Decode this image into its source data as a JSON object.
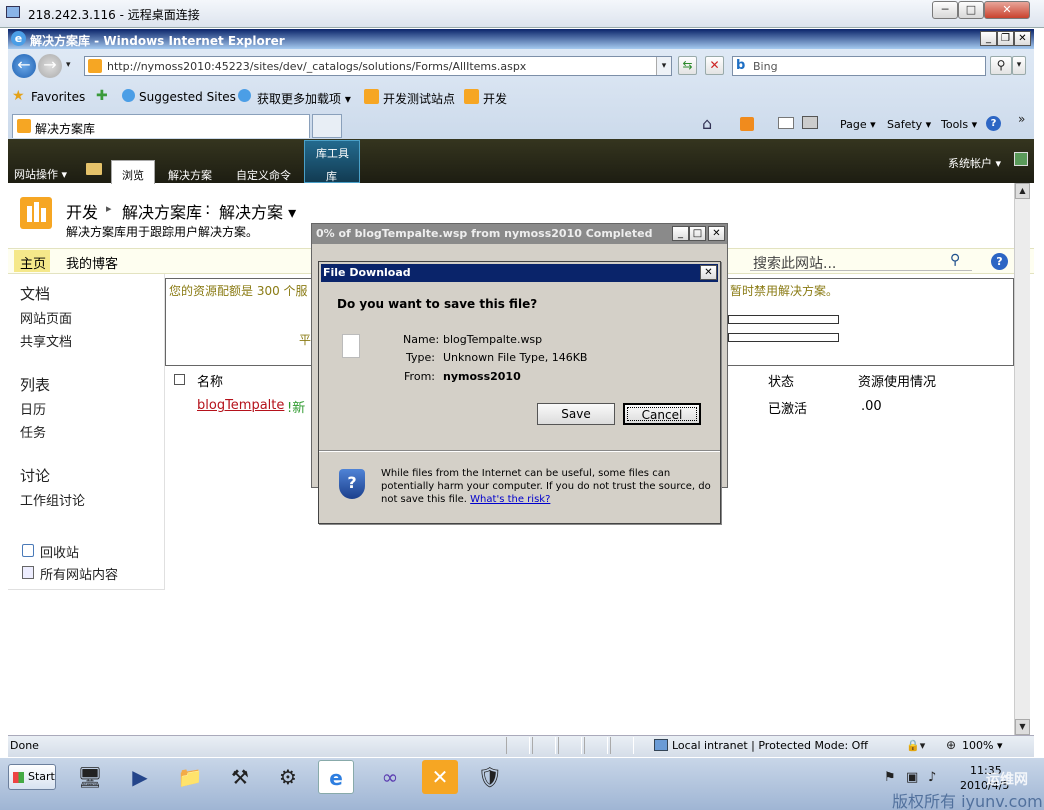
{
  "rdp": {
    "title": "218.242.3.116 - 远程桌面连接"
  },
  "ie": {
    "window_title": "解决方案库 - Windows Internet Explorer",
    "address": "http://nymoss2010:45223/sites/dev/_catalogs/solutions/Forms/AllItems.aspx",
    "search_placeholder": "Bing",
    "favorites_label": "Favorites",
    "fav_items": [
      "Suggested Sites ▾",
      "获取更多加载项 ▾",
      "开发测试站点",
      "开发"
    ],
    "tab_label": "解决方案库",
    "cmd": {
      "page": "Page ▾",
      "safety": "Safety ▾",
      "tools": "Tools ▾"
    }
  },
  "sp": {
    "site_actions": "网站操作 ▾",
    "tabs": [
      "浏览",
      "解决方案",
      "自定义命令"
    ],
    "tools_group": "库工具",
    "tools_tab": "库",
    "user": "系统帐户 ▾",
    "breadcrumb": {
      "root": "开发",
      "sep": "▸",
      "lib": "解决方案库",
      "colon": ":",
      "view": "解决方案 ▾"
    },
    "description": "解决方案库用于跟踪用户解决方案。",
    "topnav": [
      "主页",
      "我的博客"
    ],
    "search_placeholder": "搜索此网站...",
    "quota_text": "您的资源配额是 300 个服",
    "quota_text_right": "暂时禁用解决方案。",
    "quota_partial": "平",
    "left": {
      "docs_head": "文档",
      "docs": [
        "网站页面",
        "共享文档"
      ],
      "lists_head": "列表",
      "lists": [
        "日历",
        "任务"
      ],
      "disc_head": "讨论",
      "disc": [
        "工作组讨论"
      ],
      "recycle": "回收站",
      "all_content": "所有网站内容"
    },
    "columns": {
      "name": "名称",
      "status": "状态",
      "usage": "资源使用情况"
    },
    "row": {
      "name": "blogTempalte",
      "new": "!新",
      "status": "已激活",
      "usage": ".00"
    }
  },
  "progress_dialog": {
    "title": "0% of blogTempalte.wsp from nymoss2010 Completed"
  },
  "file_dialog": {
    "title": "File Download",
    "question": "Do you want to save this file?",
    "name_label": "Name:",
    "name_value": "blogTempalte.wsp",
    "type_label": "Type:",
    "type_value": "Unknown File Type, 146KB",
    "from_label": "From:",
    "from_value": "nymoss2010",
    "save": "Save",
    "cancel": "Cancel",
    "warning": "While files from the Internet can be useful, some files can potentially harm your computer. If you do not trust the source, do not save this file.",
    "risk_link": "What's the risk?"
  },
  "status": {
    "done": "Done",
    "zone": "Local intranet | Protected Mode: Off",
    "zoom": "100% ▾"
  },
  "taskbar": {
    "start": "Start",
    "time": "11:35",
    "date": "2010/4/5"
  },
  "watermark": {
    "brand": "运维网",
    "line": "版权所有 iyunv.com"
  },
  "colors": {
    "ribbon": "#2b2b1f",
    "accent_blue": "#0a246a",
    "link": "#b5121b",
    "sp_orange": "#f6a623"
  }
}
